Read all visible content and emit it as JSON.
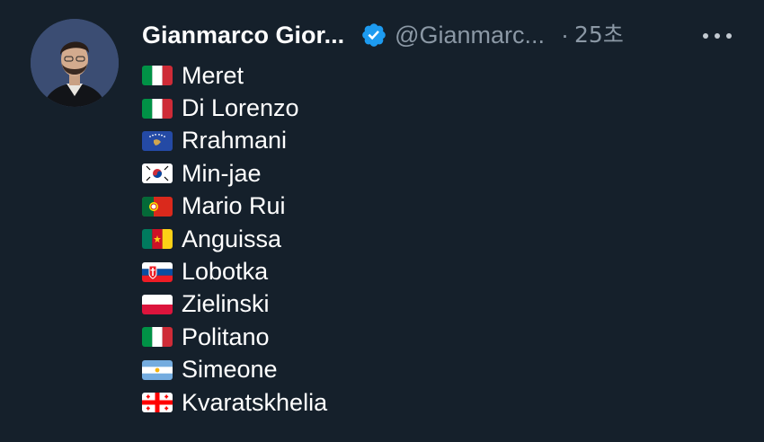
{
  "tweet": {
    "author_name": "Gianmarco Gior...",
    "handle": "@Gianmarc...",
    "separator": "·",
    "timestamp": "25초",
    "verified": true,
    "more_icon": "more-horizontal-icon",
    "avatar_icon": "user-avatar"
  },
  "lines": [
    {
      "flag": "italy-flag",
      "text": "Meret"
    },
    {
      "flag": "italy-flag",
      "text": "Di Lorenzo"
    },
    {
      "flag": "kosovo-flag",
      "text": "Rrahmani"
    },
    {
      "flag": "south-korea-flag",
      "text": "Min-jae"
    },
    {
      "flag": "portugal-flag",
      "text": "Mario Rui"
    },
    {
      "flag": "cameroon-flag",
      "text": "Anguissa"
    },
    {
      "flag": "slovakia-flag",
      "text": "Lobotka"
    },
    {
      "flag": "poland-flag",
      "text": "Zielinski"
    },
    {
      "flag": "italy-flag",
      "text": "Politano"
    },
    {
      "flag": "argentina-flag",
      "text": "Simeone"
    },
    {
      "flag": "georgia-flag",
      "text": "Kvaratskhelia"
    }
  ],
  "colors": {
    "background": "#15202b",
    "text": "#e7e9ea",
    "secondary_text": "#8b98a5",
    "verified_badge": "#1d9bf0"
  }
}
